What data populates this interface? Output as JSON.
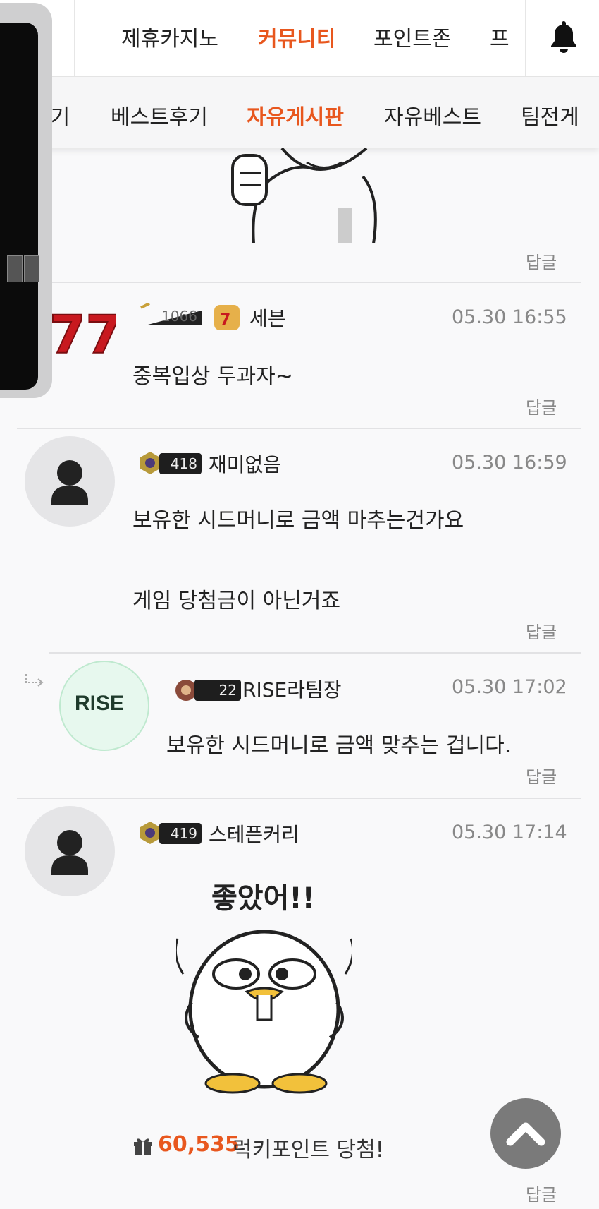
{
  "top_nav": {
    "items": [
      "제휴카지노",
      "커뮤니티",
      "포인트존",
      "프"
    ],
    "active": "커뮤니티"
  },
  "sub_nav": {
    "items": [
      "후기",
      "베스트후기",
      "자유게시판",
      "자유베스트",
      "팀전게"
    ],
    "active": "자유게시판"
  },
  "reply_label": "답글",
  "comments": [
    {
      "level": "1066",
      "nick": "세븐",
      "time": "05.30 16:55",
      "lines": [
        "중복입상 두과자~"
      ]
    },
    {
      "level": "418",
      "nick": "재미없음",
      "time": "05.30 16:59",
      "lines": [
        "보유한 시드머니로 금액 마추는건가요",
        "게임 당첨금이 아닌거죠"
      ]
    },
    {
      "level": "22",
      "nick": "RISE라팀장",
      "time": "05.30 17:02",
      "lines": [
        "보유한 시드머니로 금액 맞추는 겁니다."
      ],
      "is_reply": true,
      "avatar_text": "RISE"
    },
    {
      "level": "419",
      "nick": "스테픈커리",
      "time": "05.30 17:14",
      "sticker_text": "좋았어!!",
      "lucky_points": "60,535",
      "lucky_label": "럭키포인트 당첨!"
    }
  ],
  "colors": {
    "accent": "#e8571e",
    "muted": "#888888"
  }
}
